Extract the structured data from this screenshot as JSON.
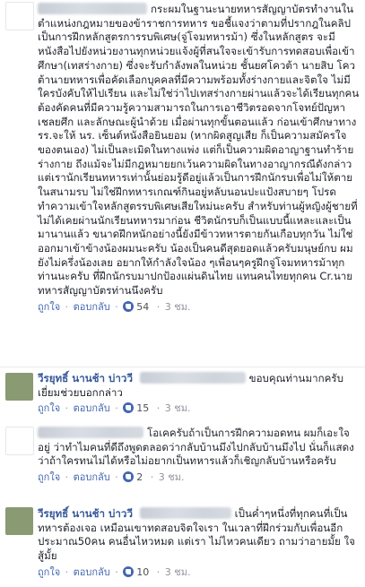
{
  "post_text": "กระผมในฐานะนายทหารสัญญาบัตรทำงานในตำแหน่งกฎหมายของข้าราชการทหาร ขอชี้แจงว่าตามที่ปรากฎในคลิป เป็นการฝึกหลักสูตรการรบพิเศษ(จู่โจมทหารม้า) ซึ่งในหลักสูตร จะมีหนังสือไปยังหน่วยงานทุกหน่วยแจ้งผู้ที่สนใจจะเข้ารับการทดสอบเพื่อเข้าศึกษา(เทสร่างกาย) ซึ่งจะรับกำลังพลในหน่วย ชั้นยศโควต้า นายสิบ โควต้านายทหารเพื่อคัดเลือกบุคคลที่มีความพร้อมทั้งร่างกายและจิตใจ ไม่มีใครบังคับให้ไปเรียน และไม่ใช่ว่าไปเทสร่างกายผ่านแล้วจะได้เรียนทุกคน ต้องคัดคนที่มีความรู้ความสามารถในการเอาชีวิตรอดจากโจทย์ปัญหาเชลยศึก และลักษณะผู้นำด้วย เมื่อผ่านทุกขั้นตอนแล้ว ก่อนเข้าศึกษาทาง รร.จะให้ นร. เซ็นต์หนังสือยินยอม (หากผิดสูญเสีย ก็เป็นความสมัครใจของตนเอง) ไม่เป็นละเมิดในทางแพ่ง แต่ก็เป็นความผิดอาญาฐานทำร้ายร่างกาย ถึงแม้จะไม่มีกฎหมายยกเว้นความผิดในทางอาญากรณีดังกล่าว แต่เรานักเรียนทหารเท่านั้นย่อมรู้ดีอยู่แล้วเป็นการฝึกนักรบเพื่อไม่ให้ตายในสนามรบ ไม่ใช่ฝึกทหารเกณฑ์กินอยู่หลับนอนปะแป้งสบายๆ โปรดทำความเข้าใจหลักสูตรรบพิเศษเสียใหม่นะครับ สำหรับท่านผู้หญิงผู้ชายที่ไม่ได้เคยผ่านนักเรียนทหารมาก่อน ชีวิตนักรบก็เป็นแบบนี้แหละและเป็นมานานแล้ว ขนาดฝึกหนักอย่างนี้ยังมีข้าวทหารตายกันเกือบทุกวัน ไม่ใช่ออกมาเข้าข้างน้องผมนะครับ น้องเป็นคนดีสุดยอดแล้วครับมนุษย์กบ ผมยังไม่ครึ่งน้องเลย อยากให้กำลังใจน้อง ๆเพื่อนๆครูฝึกจู่โจมทหารม้าทุกท่านนะครับ ที่ฝึกนักรบมาปกป้องแผ่นดินไทย แทนคนไทยทุกคน Cr.นายทหารสัญญาบัตรท่านนึงครับ",
  "post_meta": {
    "like": "ถูกใจ",
    "reply": "ตอบกลับ",
    "likes": "54",
    "time": "3 ชม."
  },
  "comments": [
    {
      "name": "วีรยุทธิ์ นานช้า บ่าววี",
      "text": "ขอบคุณท่านมากครับ เยี่ยมช่วยบอกกล่าว",
      "like": "ถูกใจ",
      "reply": "ตอบกลับ",
      "likes": "15",
      "time": "3 ชม."
    },
    {
      "name": "",
      "text": "โอเคครับถ้าเป็นการฝึกความอดทน ผมก็เอะใจอยู่ ว่าทำไมคนที่ดีถึงพูดตลอดว่ากลับบ้านมึงไปกลับบ้านมึงไป นั่นก็แสดงว่าถ้าใครทนไม่ได้หรือไม่อยากเป็นทหารแล้วก็เชิญกลับบ้านหรือครับ",
      "like": "ถูกใจ",
      "reply": "ตอบกลับ",
      "likes": "2",
      "time": "3 ชม."
    },
    {
      "name": "วีรยุทธิ์ นานช้า บ่าววี",
      "text": "เป็นค่ำๆหนึ่งที่ทุกคนที่เป็นทหารต้องเจอ เหมือนเขาทดสอบจิตใจเรา ในเวลาที่ฝึกร่วมกับเพื่อนอีกประมาณ50คน คนอื่นไหวหมด แต่เรา ไม่ไหวคนเดียว ถามว่าอายมั้ย ใจสู้มั้ย",
      "like": "ถูกใจ",
      "reply": "ตอบกลับ",
      "likes": "10",
      "time": "3 ชม."
    }
  ],
  "colors": {
    "link": "#4267b2",
    "name": "#365899",
    "meta": "#90949c",
    "text": "#1d2129",
    "like_badge": "#4267b2"
  }
}
